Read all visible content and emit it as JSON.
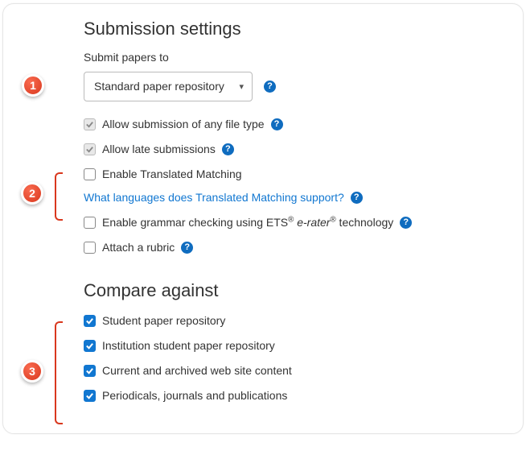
{
  "section1": {
    "title": "Submission settings",
    "submit_label": "Submit papers to",
    "repository_selected": "Standard paper repository",
    "allow_any_file": "Allow submission of any file type",
    "allow_late": "Allow late submissions",
    "enable_translated": "Enable Translated Matching",
    "translated_link": "What languages does Translated Matching support?",
    "grammar_prefix": "Enable grammar checking using ETS",
    "grammar_mid": " e-rater",
    "grammar_suffix": " technology",
    "reg_mark": "®",
    "attach_rubric": "Attach a rubric"
  },
  "section2": {
    "title": "Compare against",
    "opts": [
      "Student paper repository",
      "Institution student paper repository",
      "Current and archived web site content",
      "Periodicals, journals and publications"
    ]
  },
  "callouts": {
    "c1": "1",
    "c2": "2",
    "c3": "3"
  }
}
